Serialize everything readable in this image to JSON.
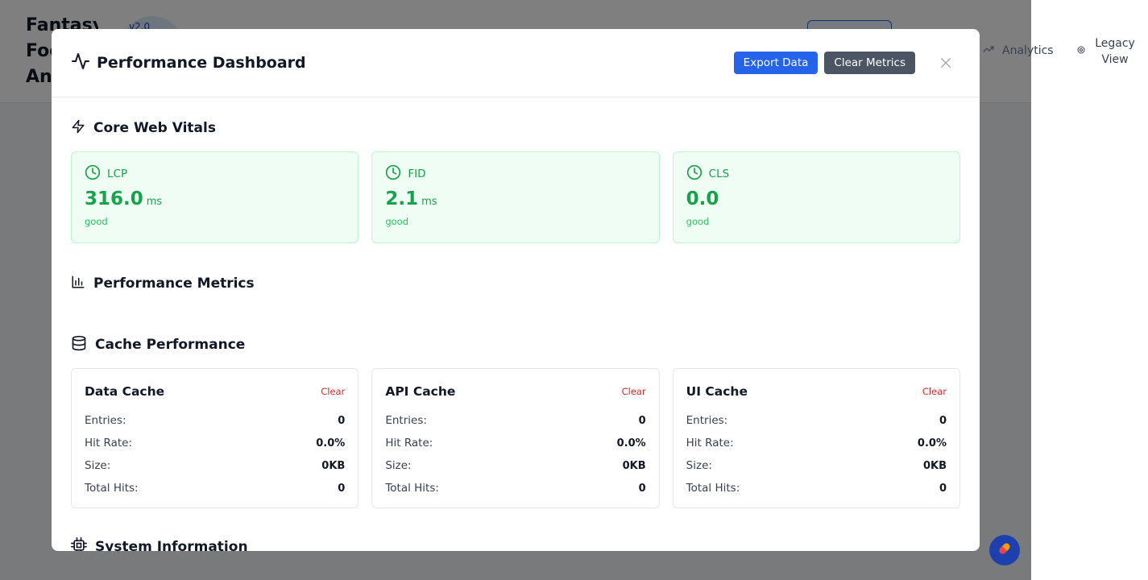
{
  "app": {
    "title": "Fantasy Football Analytics",
    "version": "v2.0",
    "nav": {
      "analytics_label": "Analytics",
      "legacy_label": "Legacy View"
    }
  },
  "modal": {
    "title": "Performance Dashboard",
    "export_label": "Export Data",
    "clear_label": "Clear Metrics",
    "close_icon": "close-icon"
  },
  "sections": {
    "core_web_vitals": "Core Web Vitals",
    "performance_metrics": "Performance Metrics",
    "cache_performance": "Cache Performance",
    "system_information": "System Information"
  },
  "vitals": [
    {
      "name": "LCP",
      "value": "316.0",
      "unit": "ms",
      "rating": "good"
    },
    {
      "name": "FID",
      "value": "2.1",
      "unit": "ms",
      "rating": "good"
    },
    {
      "name": "CLS",
      "value": "0.0",
      "unit": "",
      "rating": "good"
    }
  ],
  "cache_labels": {
    "clear": "Clear",
    "entries": "Entries:",
    "hit_rate": "Hit Rate:",
    "size": "Size:",
    "total_hits": "Total Hits:"
  },
  "caches": [
    {
      "name": "Data Cache",
      "entries": "0",
      "hit_rate": "0.0%",
      "size": "0KB",
      "total_hits": "0"
    },
    {
      "name": "API Cache",
      "entries": "0",
      "hit_rate": "0.0%",
      "size": "0KB",
      "total_hits": "0"
    },
    {
      "name": "UI Cache",
      "entries": "0",
      "hit_rate": "0.0%",
      "size": "0KB",
      "total_hits": "0"
    }
  ],
  "colors": {
    "primary": "#2563eb",
    "good": "#16a34a",
    "danger": "#dc2626"
  }
}
